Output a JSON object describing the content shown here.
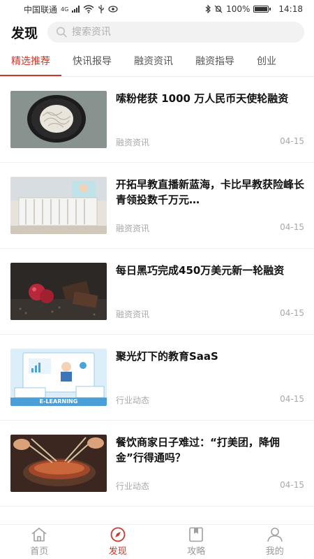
{
  "status_bar": {
    "carrier": "中国联通",
    "network": "4G",
    "battery": "100%",
    "time": "14:18"
  },
  "header": {
    "title": "发现",
    "search_placeholder": "搜索资讯"
  },
  "tabs": [
    {
      "label": "精选推荐",
      "active": true
    },
    {
      "label": "快讯报导",
      "active": false
    },
    {
      "label": "融资资讯",
      "active": false
    },
    {
      "label": "融资指导",
      "active": false
    },
    {
      "label": "创业",
      "active": false
    }
  ],
  "news": [
    {
      "title": "嗦粉佬获 1000 万人民币天使轮融资",
      "category": "融资资讯",
      "date": "04-15",
      "thumb_icon": "rice-noodles-image"
    },
    {
      "title": "开拓早教直播新蓝海，卡比早教获险峰长青领投数千万元…",
      "category": "融资资讯",
      "date": "04-15",
      "thumb_icon": "playroom-image"
    },
    {
      "title": "每日黑巧完成450万美元新一轮融资",
      "category": "融资资讯",
      "date": "04-15",
      "thumb_icon": "chocolate-image"
    },
    {
      "title": "聚光灯下的教育SaaS",
      "category": "行业动态",
      "date": "04-15",
      "thumb_icon": "e-learning-image",
      "thumb_text": "E-LEARNING"
    },
    {
      "title": "餐饮商家日子难过：“打美团，降佣金”行得通吗？",
      "category": "行业动态",
      "date": "04-15",
      "thumb_icon": "hotpot-image"
    }
  ],
  "bottom_nav": [
    {
      "label": "首页",
      "icon": "home-icon",
      "active": false
    },
    {
      "label": "发现",
      "icon": "compass-icon",
      "active": true
    },
    {
      "label": "攻略",
      "icon": "bookmark-book-icon",
      "active": false
    },
    {
      "label": "我的",
      "icon": "user-icon",
      "active": false
    }
  ],
  "colors": {
    "accent": "#c8392b",
    "muted": "#a8a8a8"
  }
}
